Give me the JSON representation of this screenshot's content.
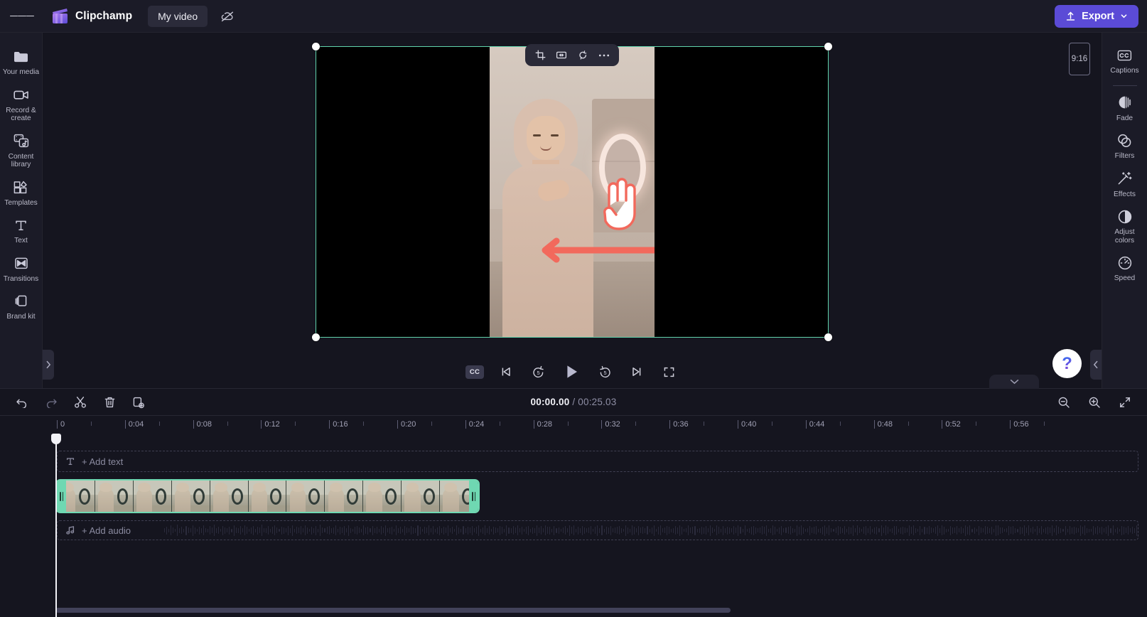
{
  "topbar": {
    "menu_icon": "hamburger-menu-icon",
    "brand": "Clipchamp",
    "project_name": "My video",
    "cloud_icon": "cloud-off-icon",
    "export_label": "Export",
    "export_icon": "upload-arrow-icon",
    "export_chevron": "chevron-down-icon",
    "accent_color": "#5b4bd6"
  },
  "left_rail": {
    "items": [
      {
        "label": "Your media",
        "icon": "folder-icon"
      },
      {
        "label": "Record & create",
        "icon": "video-camera-icon"
      },
      {
        "label": "Content library",
        "icon": "content-library-icon"
      },
      {
        "label": "Templates",
        "icon": "templates-grid-icon"
      },
      {
        "label": "Text",
        "icon": "text-t-icon"
      },
      {
        "label": "Transitions",
        "icon": "transitions-icon"
      },
      {
        "label": "Brand kit",
        "icon": "brand-kit-icon"
      }
    ],
    "collapse_icon": "chevron-right-icon"
  },
  "right_rail": {
    "items": [
      {
        "label": "Captions",
        "icon": "cc-icon"
      },
      {
        "label": "Fade",
        "icon": "fade-circle-icon"
      },
      {
        "label": "Filters",
        "icon": "filters-overlap-circles-icon"
      },
      {
        "label": "Effects",
        "icon": "magic-wand-sparkle-icon"
      },
      {
        "label": "Adjust colors",
        "icon": "half-filled-circle-icon"
      },
      {
        "label": "Speed",
        "icon": "speedometer-icon"
      }
    ],
    "collapse_icon": "chevron-left-icon"
  },
  "canvas": {
    "float_toolbar": [
      {
        "icon": "crop-icon",
        "name": "crop-button"
      },
      {
        "icon": "fit-fill-icon",
        "name": "fit-fill-button"
      },
      {
        "icon": "rotate-icon",
        "name": "rotate-button"
      },
      {
        "icon": "more-horizontal-icon",
        "name": "more-options-button"
      }
    ],
    "aspect_ratio": "9:16",
    "selection_color": "#61d3ac",
    "overlay_arrow_color": "#f2695c",
    "help_label": "?"
  },
  "player": {
    "controls": [
      {
        "name": "captions-toggle",
        "icon": "cc-icon",
        "label": "CC"
      },
      {
        "name": "skip-to-start-button",
        "icon": "skip-previous-icon"
      },
      {
        "name": "rewind-5-button",
        "icon": "rewind-5-icon",
        "label": "5"
      },
      {
        "name": "play-button",
        "icon": "play-icon"
      },
      {
        "name": "forward-5-button",
        "icon": "forward-5-icon",
        "label": "5"
      },
      {
        "name": "skip-to-end-button",
        "icon": "skip-next-icon"
      },
      {
        "name": "fullscreen-button",
        "icon": "fullscreen-icon"
      }
    ]
  },
  "timeline": {
    "tools": [
      {
        "name": "undo-button",
        "icon": "undo-arrow-icon",
        "dim": false
      },
      {
        "name": "redo-button",
        "icon": "redo-arrow-icon",
        "dim": true
      },
      {
        "name": "split-button",
        "icon": "scissors-icon",
        "dim": false
      },
      {
        "name": "delete-button",
        "icon": "trash-icon",
        "dim": false
      },
      {
        "name": "duplicate-button",
        "icon": "duplicate-plus-icon",
        "dim": false
      }
    ],
    "current_time": "00:00.00",
    "total_time": "00:25.03",
    "time_separator": "/",
    "zoom_tools": [
      {
        "name": "zoom-out-button",
        "icon": "magnifier-minus-icon"
      },
      {
        "name": "zoom-in-button",
        "icon": "magnifier-plus-icon"
      },
      {
        "name": "fit-timeline-button",
        "icon": "shrink-arrows-icon"
      }
    ],
    "collapse_icon": "chevron-down-icon",
    "ruler_labels": [
      "0",
      "0:04",
      "0:08",
      "0:12",
      "0:16",
      "0:20",
      "0:24",
      "0:28",
      "0:32",
      "0:36",
      "0:40",
      "0:44",
      "0:48",
      "0:52",
      "0:56"
    ],
    "add_text_label": "+ Add text",
    "add_text_icon": "text-t-icon",
    "add_audio_label": "+ Add audio",
    "add_audio_icon": "music-note-icon",
    "clip_selected_color": "#6fd8b2"
  }
}
